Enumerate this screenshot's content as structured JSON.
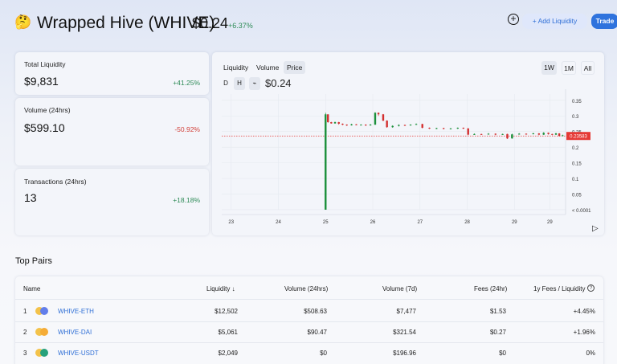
{
  "header": {
    "token_logo": "🤔",
    "token_name": "Wrapped Hive (WHIVE)",
    "price": "$0.24",
    "change": "+6.37%",
    "add_liquidity_label": "+ Add Liquidity",
    "trade_label": "Trade",
    "plus_icon": "⊕"
  },
  "stats": [
    {
      "label": "Total Liquidity",
      "value": "$9,831",
      "change": "+41.25%",
      "direction": "up"
    },
    {
      "label": "Volume (24hrs)",
      "value": "$599.10",
      "change": "-50.92%",
      "direction": "down"
    },
    {
      "label": "Transactions (24hrs)",
      "value": "13",
      "change": "+18.18%",
      "direction": "up"
    }
  ],
  "chart": {
    "tabs": [
      "Liquidity",
      "Volume",
      "Price"
    ],
    "active_tab": "Price",
    "interval_buttons": [
      "D",
      "H"
    ],
    "line_icon": "⌁",
    "current_price": "$0.24",
    "ranges": [
      "1W",
      "1M",
      "All"
    ],
    "active_range": "1W",
    "price_marker": "0.23583",
    "play_icon": "▷",
    "colors": {
      "up": "#1a8f3a",
      "down": "#d32f2f",
      "marker": "#e53935"
    }
  },
  "chart_data": {
    "type": "candlestick",
    "x_ticks": [
      "23",
      "24",
      "25",
      "26",
      "27",
      "28",
      "29",
      "29"
    ],
    "y_ticks": [
      "0.35",
      "0.3",
      "0.25",
      "0.2",
      "0.15",
      "0.1",
      "0.05",
      "< 0.0001"
    ],
    "ylim": [
      0,
      0.37
    ],
    "last_price": 0.23583,
    "candles": [
      {
        "x": 25.0,
        "o": 0.0001,
        "c": 0.305,
        "h": 0.31,
        "l": 0.0001
      },
      {
        "x": 25.05,
        "o": 0.305,
        "c": 0.28,
        "h": 0.305,
        "l": 0.278
      },
      {
        "x": 25.12,
        "o": 0.28,
        "c": 0.276,
        "h": 0.281,
        "l": 0.275
      },
      {
        "x": 25.2,
        "o": 0.276,
        "c": 0.28,
        "h": 0.282,
        "l": 0.275
      },
      {
        "x": 25.28,
        "o": 0.28,
        "c": 0.275,
        "h": 0.281,
        "l": 0.272
      },
      {
        "x": 25.36,
        "o": 0.275,
        "c": 0.272,
        "h": 0.276,
        "l": 0.27
      },
      {
        "x": 25.45,
        "o": 0.272,
        "c": 0.27,
        "h": 0.273,
        "l": 0.268
      },
      {
        "x": 25.55,
        "o": 0.27,
        "c": 0.273,
        "h": 0.275,
        "l": 0.269
      },
      {
        "x": 25.65,
        "o": 0.273,
        "c": 0.271,
        "h": 0.274,
        "l": 0.27
      },
      {
        "x": 25.75,
        "o": 0.271,
        "c": 0.272,
        "h": 0.273,
        "l": 0.27
      },
      {
        "x": 25.85,
        "o": 0.272,
        "c": 0.27,
        "h": 0.273,
        "l": 0.268
      },
      {
        "x": 25.95,
        "o": 0.27,
        "c": 0.272,
        "h": 0.274,
        "l": 0.269
      },
      {
        "x": 26.05,
        "o": 0.272,
        "c": 0.31,
        "h": 0.312,
        "l": 0.271
      },
      {
        "x": 26.12,
        "o": 0.31,
        "c": 0.305,
        "h": 0.311,
        "l": 0.3
      },
      {
        "x": 26.22,
        "o": 0.305,
        "c": 0.285,
        "h": 0.306,
        "l": 0.283
      },
      {
        "x": 26.3,
        "o": 0.285,
        "c": 0.264,
        "h": 0.286,
        "l": 0.262
      },
      {
        "x": 26.42,
        "o": 0.264,
        "c": 0.268,
        "h": 0.27,
        "l": 0.262
      },
      {
        "x": 26.55,
        "o": 0.268,
        "c": 0.271,
        "h": 0.273,
        "l": 0.266
      },
      {
        "x": 26.68,
        "o": 0.271,
        "c": 0.27,
        "h": 0.272,
        "l": 0.268
      },
      {
        "x": 26.8,
        "o": 0.27,
        "c": 0.272,
        "h": 0.273,
        "l": 0.269
      },
      {
        "x": 26.92,
        "o": 0.272,
        "c": 0.274,
        "h": 0.276,
        "l": 0.271
      },
      {
        "x": 27.05,
        "o": 0.274,
        "c": 0.262,
        "h": 0.275,
        "l": 0.26
      },
      {
        "x": 27.2,
        "o": 0.262,
        "c": 0.26,
        "h": 0.263,
        "l": 0.258
      },
      {
        "x": 27.35,
        "o": 0.26,
        "c": 0.261,
        "h": 0.262,
        "l": 0.258
      },
      {
        "x": 27.5,
        "o": 0.261,
        "c": 0.259,
        "h": 0.262,
        "l": 0.257
      },
      {
        "x": 27.65,
        "o": 0.259,
        "c": 0.26,
        "h": 0.261,
        "l": 0.257
      },
      {
        "x": 27.8,
        "o": 0.26,
        "c": 0.262,
        "h": 0.263,
        "l": 0.258
      },
      {
        "x": 27.92,
        "o": 0.262,
        "c": 0.26,
        "h": 0.263,
        "l": 0.258
      },
      {
        "x": 28.02,
        "o": 0.26,
        "c": 0.24,
        "h": 0.261,
        "l": 0.238
      },
      {
        "x": 28.15,
        "o": 0.24,
        "c": 0.242,
        "h": 0.244,
        "l": 0.239
      },
      {
        "x": 28.3,
        "o": 0.242,
        "c": 0.241,
        "h": 0.243,
        "l": 0.239
      },
      {
        "x": 28.45,
        "o": 0.241,
        "c": 0.243,
        "h": 0.245,
        "l": 0.24
      },
      {
        "x": 28.6,
        "o": 0.243,
        "c": 0.24,
        "h": 0.244,
        "l": 0.238
      },
      {
        "x": 28.75,
        "o": 0.24,
        "c": 0.242,
        "h": 0.243,
        "l": 0.239
      },
      {
        "x": 28.85,
        "o": 0.242,
        "c": 0.228,
        "h": 0.243,
        "l": 0.226
      },
      {
        "x": 28.95,
        "o": 0.228,
        "c": 0.241,
        "h": 0.243,
        "l": 0.227
      },
      {
        "x": 29.1,
        "o": 0.241,
        "c": 0.243,
        "h": 0.245,
        "l": 0.24
      },
      {
        "x": 29.25,
        "o": 0.243,
        "c": 0.242,
        "h": 0.244,
        "l": 0.24
      },
      {
        "x": 29.4,
        "o": 0.242,
        "c": 0.244,
        "h": 0.246,
        "l": 0.241
      },
      {
        "x": 29.52,
        "o": 0.244,
        "c": 0.24,
        "h": 0.245,
        "l": 0.238
      },
      {
        "x": 29.62,
        "o": 0.24,
        "c": 0.246,
        "h": 0.248,
        "l": 0.239
      },
      {
        "x": 29.72,
        "o": 0.246,
        "c": 0.242,
        "h": 0.247,
        "l": 0.24
      },
      {
        "x": 29.8,
        "o": 0.242,
        "c": 0.24,
        "h": 0.243,
        "l": 0.238
      },
      {
        "x": 29.88,
        "o": 0.24,
        "c": 0.244,
        "h": 0.246,
        "l": 0.239
      },
      {
        "x": 29.95,
        "o": 0.244,
        "c": 0.236,
        "h": 0.245,
        "l": 0.234
      },
      {
        "x": 30.02,
        "o": 0.236,
        "c": 0.238,
        "h": 0.24,
        "l": 0.235
      }
    ]
  },
  "pairs": {
    "title": "Top Pairs",
    "columns": [
      "Name",
      "Liquidity ↓",
      "Volume (24hrs)",
      "Volume (7d)",
      "Fees (24hr)",
      "1y Fees / Liquidity"
    ],
    "rows": [
      {
        "rank": "1",
        "name": "WHIVE-ETH",
        "liquidity": "$12,502",
        "vol24": "$508.63",
        "vol7d": "$7,477",
        "fees": "$1.53",
        "ratio": "+4.45%",
        "ratio_dir": "up",
        "icon2": "#627eea"
      },
      {
        "rank": "2",
        "name": "WHIVE-DAI",
        "liquidity": "$5,061",
        "vol24": "$90.47",
        "vol7d": "$321.54",
        "fees": "$0.27",
        "ratio": "+1.96%",
        "ratio_dir": "up",
        "icon2": "#f5ac37"
      },
      {
        "rank": "3",
        "name": "WHIVE-USDT",
        "liquidity": "$2,049",
        "vol24": "$0",
        "vol7d": "$196.96",
        "fees": "$0",
        "ratio": "0%",
        "ratio_dir": "flat",
        "icon2": "#26a17b"
      }
    ]
  }
}
